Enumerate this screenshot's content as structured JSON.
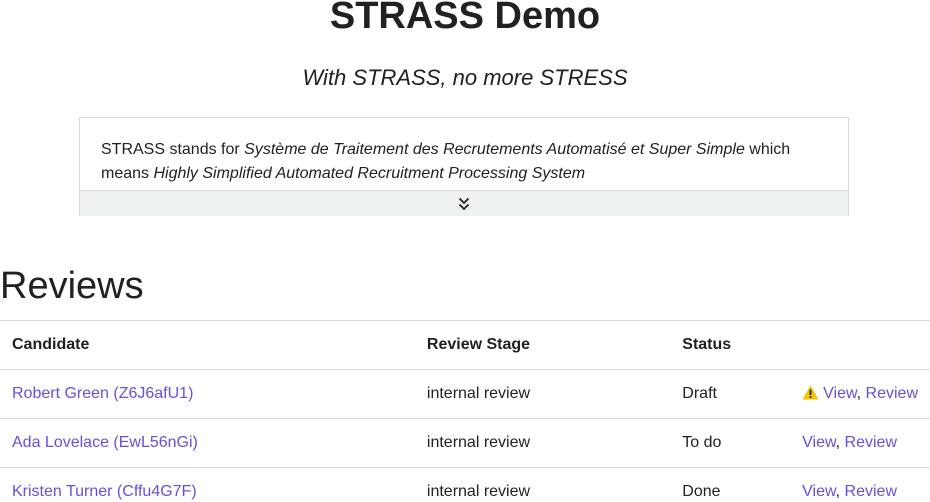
{
  "header": {
    "title": "STRASS Demo",
    "subtitle": "With STRASS, no more STRESS"
  },
  "intro": {
    "prefix": "STRASS stands for ",
    "french_name": "Système de Traitement des Recrutements Automatisé et Super Simple",
    "middle": " which means ",
    "english_name": "Highly Simplified Automated Recruitment Processing System",
    "expand_icon": "chevron-double-down-icon"
  },
  "reviews": {
    "title": "Reviews",
    "columns": [
      "Candidate",
      "Review Stage",
      "Status",
      ""
    ],
    "rows": [
      {
        "candidate": "Robert Green (Z6J6afU1)",
        "stage": "internal review",
        "status": "Draft",
        "warning": true,
        "view": "View",
        "review": "Review"
      },
      {
        "candidate": "Ada Lovelace (EwL56nGi)",
        "stage": "internal review",
        "status": "To do",
        "warning": false,
        "view": "View",
        "review": "Review"
      },
      {
        "candidate": "Kristen Turner (Cffu4G7F)",
        "stage": "internal review",
        "status": "Done",
        "warning": false,
        "view": "View",
        "review": "Review"
      }
    ],
    "separator": ", "
  },
  "colors": {
    "link": "#6a4fd6",
    "warning": "#f5c400",
    "expand_bar": "#eef1f2"
  }
}
